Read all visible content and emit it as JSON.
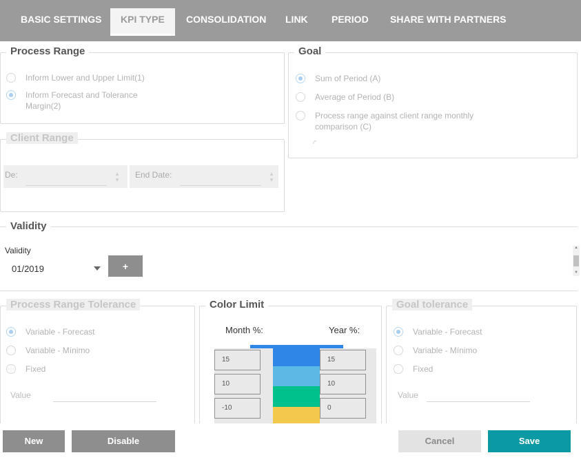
{
  "tabs": [
    {
      "label": "BASIC SETTINGS"
    },
    {
      "label": "KPI TYPE"
    },
    {
      "label": "CONSOLIDATION"
    },
    {
      "label": "LINK"
    },
    {
      "label": "PERIOD"
    },
    {
      "label": "SHARE WITH PARTNERS"
    }
  ],
  "active_tab": "KPI TYPE",
  "process_range": {
    "title": "Process Range",
    "options": [
      {
        "label": "Inform Lower and Upper Limit(1)",
        "checked": false
      },
      {
        "label": "Inform Forecast and Tolerance",
        "label2": "Margin(2)",
        "checked": true
      }
    ]
  },
  "goal": {
    "title": "Goal",
    "options": [
      {
        "label": "Sum of Period (A)",
        "checked": true
      },
      {
        "label": "Average of Period (B)",
        "checked": false
      },
      {
        "label": "Process range against client range monthly",
        "label2": "comparison (C)",
        "checked": false
      }
    ]
  },
  "client_range": {
    "title": "Client Range",
    "start_label": "De:",
    "end_label": "End Date:"
  },
  "validity": {
    "title": "Validity",
    "field_label": "Validity",
    "selected": "01/2019",
    "add_label": "+"
  },
  "process_range_tolerance": {
    "title": "Process Range Tolerance",
    "options": [
      {
        "label": "Variable - Forecast",
        "checked": true
      },
      {
        "label": "Variable - Mínimo",
        "checked": false
      },
      {
        "label": "Fixed",
        "checked": false
      }
    ],
    "value_label": "Value"
  },
  "color_limit": {
    "title": "Color Limit",
    "month_label": "Month %:",
    "year_label": "Year %:",
    "month_values": [
      "15",
      "10",
      "-10"
    ],
    "year_values": [
      "15",
      "10",
      "0"
    ],
    "colors": {
      "top": "#2f86e6",
      "band1": "#2f86e6",
      "band2": "#5cb8e4",
      "band3": "#00c08b",
      "band4": "#f2c94c"
    }
  },
  "goal_tolerance": {
    "title": "Goal tolerance",
    "options": [
      {
        "label": "Variable - Forecast",
        "checked": true
      },
      {
        "label": "Variable - Mínimo",
        "checked": false
      },
      {
        "label": "Fixed",
        "checked": false
      }
    ],
    "value_label": "Value"
  },
  "footer": {
    "new_label": "New",
    "disable_label": "Disable",
    "cancel_label": "Cancel",
    "save_label": "Save"
  },
  "colors": {
    "accent": "#0b9aa5",
    "tabbar": "#9b9b9b"
  }
}
